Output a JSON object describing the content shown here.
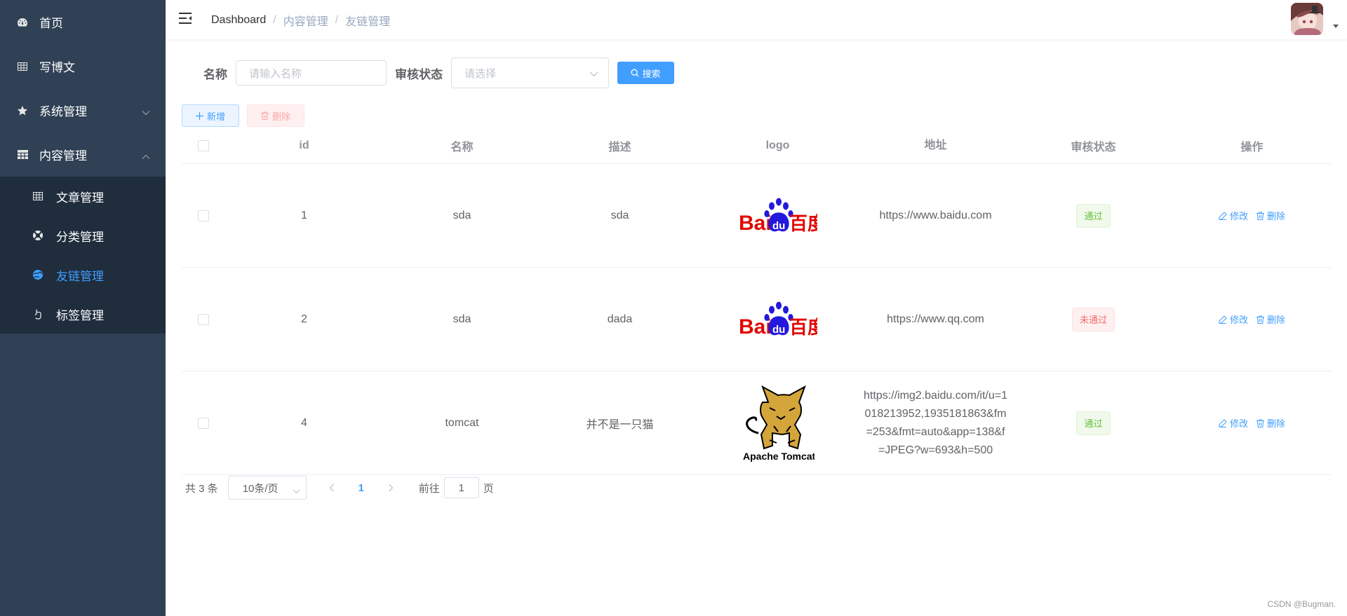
{
  "sidebar": {
    "items": [
      {
        "label": "首页",
        "icon": "dashboard-icon"
      },
      {
        "label": "写博文",
        "icon": "table-icon"
      },
      {
        "label": "系统管理",
        "icon": "star-icon"
      },
      {
        "label": "内容管理",
        "icon": "grid-icon"
      }
    ],
    "sub_items": [
      {
        "label": "文章管理",
        "icon": "table-icon"
      },
      {
        "label": "分类管理",
        "icon": "lifebuoy-icon"
      },
      {
        "label": "友链管理",
        "icon": "globe-icon"
      },
      {
        "label": "标签管理",
        "icon": "hand-icon"
      }
    ],
    "active_color": "#409eff"
  },
  "header": {
    "breadcrumb": [
      "Dashboard",
      "内容管理",
      "友链管理"
    ]
  },
  "search": {
    "name_label": "名称",
    "name_placeholder": "请输入名称",
    "status_label": "审核状态",
    "status_placeholder": "请选择",
    "search_button": "搜索"
  },
  "toolbar": {
    "add_label": "新增",
    "delete_label": "删除"
  },
  "table": {
    "columns": [
      "id",
      "名称",
      "描述",
      "logo",
      "地址",
      "审核状态",
      "操作"
    ],
    "rows": [
      {
        "id": "1",
        "name": "sda",
        "desc": "sda",
        "logo": "baidu-logo",
        "url": "https://www.baidu.com",
        "status": "通过",
        "status_type": "ok"
      },
      {
        "id": "2",
        "name": "sda",
        "desc": "dada",
        "logo": "baidu-logo",
        "url": "https://www.qq.com",
        "status": "未通过",
        "status_type": "no"
      },
      {
        "id": "4",
        "name": "tomcat",
        "desc": "并不是一只猫",
        "logo": "tomcat-logo",
        "url": "https://img2.baidu.com/it/u=1018213952,1935181863&fm=253&fmt=auto&app=138&f=JPEG?w=693&h=500",
        "status": "通过",
        "status_type": "ok"
      }
    ],
    "edit_label": "修改",
    "delete_label": "删除"
  },
  "pagination": {
    "total_text": "共 3 条",
    "page_size": "10条/页",
    "current_page": "1",
    "goto_label": "前往",
    "goto_value": "1",
    "page_suffix": "页"
  },
  "logos": {
    "baidu_left": "Bai",
    "baidu_mid": "du",
    "baidu_right": "百度",
    "tomcat_text": "Apache Tomcat"
  },
  "watermark": "CSDN @Bugman."
}
